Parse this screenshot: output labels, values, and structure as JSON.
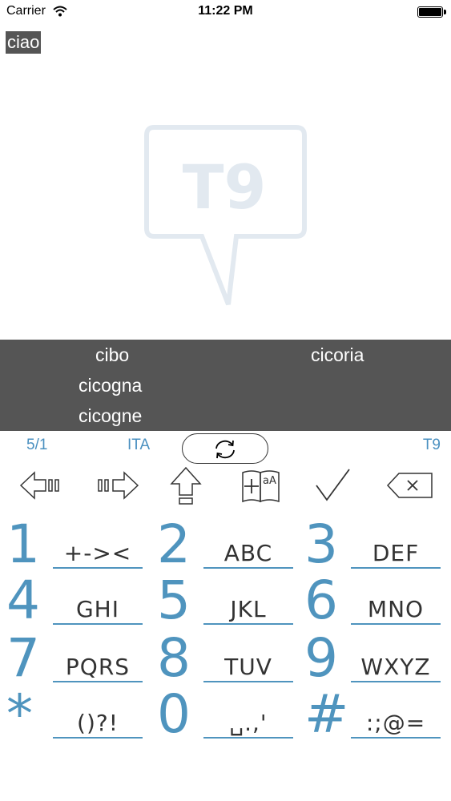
{
  "status_bar": {
    "carrier": "Carrier",
    "time": "11:22 PM"
  },
  "editor": {
    "text": "ciao",
    "watermark": "T9"
  },
  "suggestions": [
    "cibo",
    "cicoria",
    "cicogna",
    "cicogne"
  ],
  "info_row": {
    "count": "5/1",
    "language": "ITA",
    "mode": "T9"
  },
  "actions": {
    "icons": [
      "arrow-left-icon",
      "arrow-right-icon",
      "shift-icon",
      "dictionary-icon",
      "checkmark-icon",
      "backspace-icon"
    ]
  },
  "keys": [
    {
      "digit": "1",
      "letters": "+-><"
    },
    {
      "digit": "2",
      "letters": "ABC"
    },
    {
      "digit": "3",
      "letters": "DEF"
    },
    {
      "digit": "4",
      "letters": "GHI"
    },
    {
      "digit": "5",
      "letters": "JKL"
    },
    {
      "digit": "6",
      "letters": "MNO"
    },
    {
      "digit": "7",
      "letters": "PQRS"
    },
    {
      "digit": "8",
      "letters": "TUV"
    },
    {
      "digit": "9",
      "letters": "WXYZ"
    },
    {
      "digit": "*",
      "letters": "()?!"
    },
    {
      "digit": "0",
      "letters": "␣.,'"
    },
    {
      "digit": "#",
      "letters": ":;@="
    }
  ],
  "colors": {
    "accent": "#4f94be",
    "suggestion_bg": "#555555",
    "text_highlight_bg": "#555555"
  }
}
